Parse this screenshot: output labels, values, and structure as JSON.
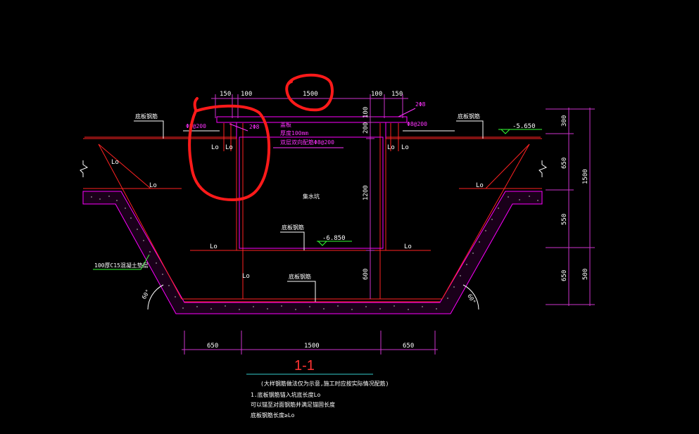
{
  "colors": {
    "background": "#000000",
    "dimension": "#cc33cc",
    "rebar": "#ff2222",
    "concrete": "#ff00ff",
    "annotation": "#ffffff",
    "magenta_text": "#ff33ff",
    "leader": "#33ff33",
    "title_line": "#33cccc",
    "markup": "#ff1a1a"
  },
  "top_dimensions": {
    "d150_left": "150",
    "d100_left": "100",
    "d1500": "1500",
    "d100_right": "100",
    "d150_right": "150"
  },
  "inner_dimensions": {
    "d100_top": "100",
    "d200": "200",
    "d1200": "1200",
    "d600": "600"
  },
  "right_dimensions": {
    "d300": "300",
    "d650": "650",
    "d550": "550",
    "d650_bottom": "650",
    "d1500": "1500",
    "d500": "500"
  },
  "bottom_dimensions": {
    "left": "650",
    "middle": "1500",
    "right": "650"
  },
  "labels": {
    "anchor_lengths": [
      "Lo",
      "Lo",
      "Lo",
      "Lo",
      "Lo",
      "Lo",
      "Lo",
      "Lo",
      "Lo",
      "Lo"
    ],
    "bar_left": "Φ8@200",
    "bar_right": "Φ8@200",
    "bar_count_left": "2Φ8",
    "bar_count_right": "2Φ8",
    "note_block": [
      "盖板",
      "厚度100mm",
      "双层双向配筋Φ8@200"
    ],
    "pit_label": "集水坑",
    "slab_rebar_left": "底板钢筋",
    "slab_rebar_right": "底板钢筋",
    "slab_rebar_mid": "底板钢筋",
    "slab_rebar_bottom": "底板钢筋",
    "elevation_top": "-5.650",
    "elevation_pit": "-6.850",
    "cushion": "100厚C15混凝土垫层",
    "angle_left": "60°",
    "angle_right": "60°"
  },
  "title": "1-1",
  "notes": {
    "header": "(大样钢筋做法仅为示意,施工时应按实际情况配筋)",
    "lines": [
      "1.底板钢筋锚入坑底长度Lo",
      "可以锚至对面钢筋并满足锚固长度",
      "底板钢筋长度≥Lo"
    ]
  }
}
